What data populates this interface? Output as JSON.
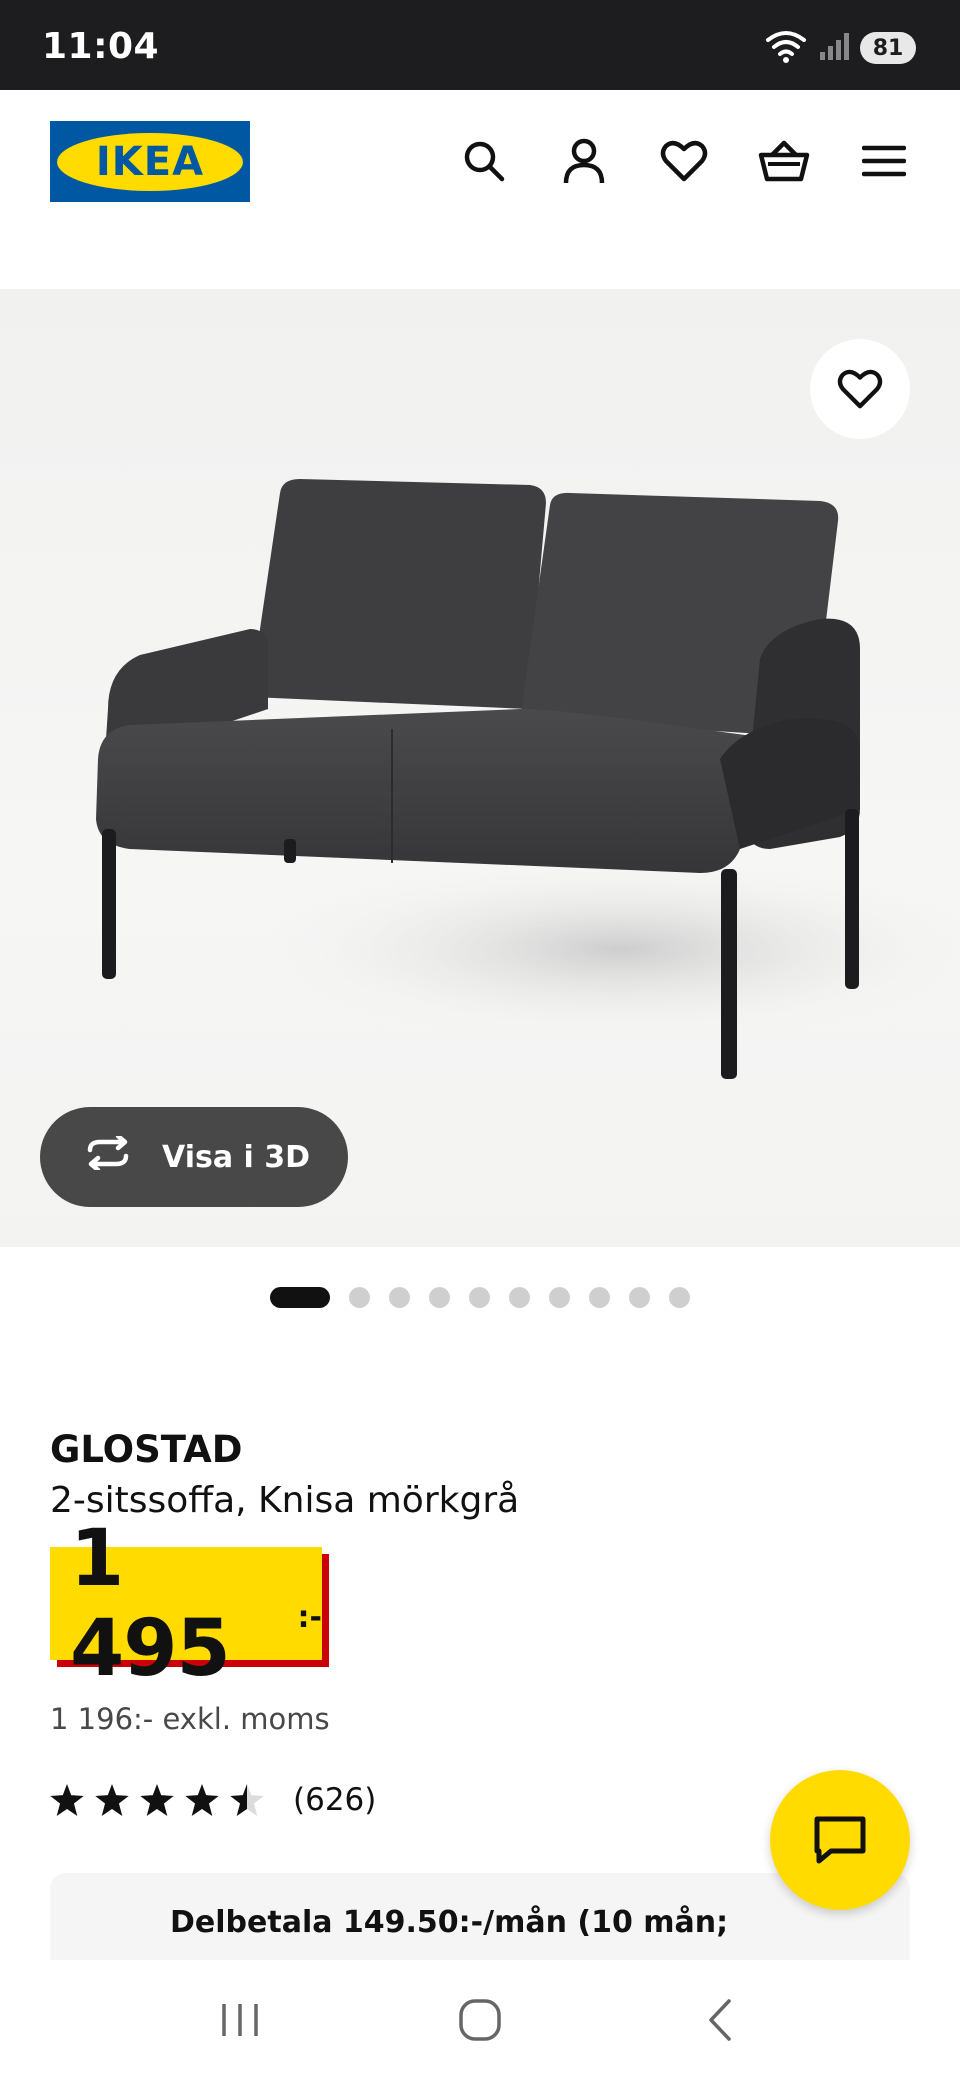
{
  "status_bar": {
    "time": "11:04",
    "battery": "81",
    "icons": [
      "wifi-icon",
      "signal-icon",
      "battery-icon"
    ]
  },
  "header": {
    "logo_text": "IKEA",
    "icons": [
      "search-icon",
      "account-icon",
      "heart-icon",
      "basket-icon",
      "menu-icon"
    ]
  },
  "gallery": {
    "view_3d_label": "Visa i 3D",
    "image_count": 10,
    "active_index": 0
  },
  "product": {
    "name": "GLOSTAD",
    "description": "2-sitssoffa, Knisa mörkgrå",
    "price": "1 495",
    "price_suffix": ":-",
    "price_excl_vat": "1 196:- exkl. moms",
    "rating_value": 4.5,
    "rating_max": 5,
    "rating_count": "(626)"
  },
  "financing": {
    "text": "Delbetala 149.50:-/mån (10 mån;"
  },
  "colors": {
    "ikea_blue": "#0058a3",
    "ikea_yellow": "#ffdb00",
    "price_shadow_red": "#cc0008",
    "view3d_button": "#484848"
  },
  "nav": {
    "icons": [
      "recent-apps-icon",
      "home-icon",
      "back-icon"
    ]
  }
}
